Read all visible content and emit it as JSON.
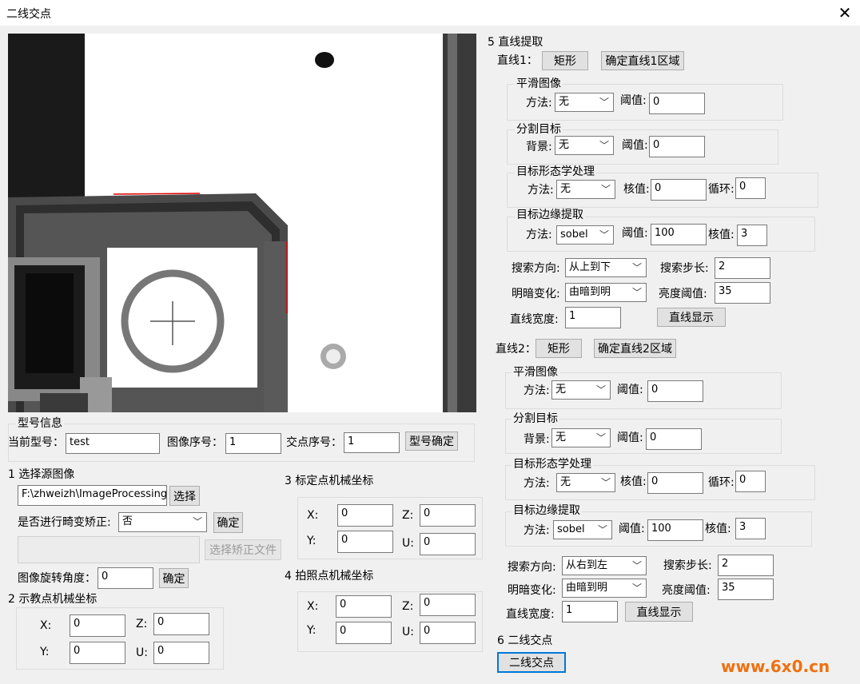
{
  "window": {
    "title": "二线交点",
    "close_glyph": "✕"
  },
  "model": {
    "group": "型号信息",
    "current_model_label": "当前型号：",
    "current_model_value": "test",
    "image_no_label": "图像序号：",
    "image_no_value": "1",
    "cross_no_label": "交点序号：",
    "cross_no_value": "1",
    "confirm": "型号确定"
  },
  "source": {
    "title": "1 选择源图像",
    "path_value": "F:\\zhweizh\\ImageProcessing\\定",
    "select_btn": "选择",
    "distort_label": "是否进行畸变矫正:",
    "distort_value": "否",
    "confirm_btn": "确定",
    "correction_file_btn": "选择矫正文件",
    "rotate_label": "图像旋转角度：",
    "rotate_value": "0",
    "rotate_confirm": "确定"
  },
  "teach": {
    "title": "2 示教点机械坐标",
    "x_label": "X:",
    "x": "0",
    "y_label": "Y:",
    "y": "0",
    "z_label": "Z:",
    "z": "0",
    "u_label": "U:",
    "u": "0"
  },
  "calib": {
    "title": "3 标定点机械坐标",
    "x_label": "X:",
    "x": "0",
    "y_label": "Y:",
    "y": "0",
    "z_label": "Z:",
    "z": "0",
    "u_label": "U:",
    "u": "0"
  },
  "shoot": {
    "title": "4 拍照点机械坐标",
    "x_label": "X:",
    "x": "0",
    "y_label": "Y:",
    "y": "0",
    "z_label": "Z:",
    "z": "0",
    "u_label": "U:",
    "u": "0"
  },
  "extract": {
    "title": "5 直线提取"
  },
  "line1": {
    "label": "直线1：",
    "rect_btn": "矩形",
    "region_btn": "确定直线1区域",
    "smooth": {
      "title": "平滑图像",
      "method_label": "方法:",
      "method": "无",
      "thresh_label": "阈值:",
      "thresh": "0"
    },
    "segment": {
      "title": "分割目标",
      "bg_label": "背景:",
      "bg": "无",
      "thresh_label": "阈值:",
      "thresh": "0"
    },
    "morph": {
      "title": "目标形态学处理",
      "method_label": "方法:",
      "method": "无",
      "kernel_label": "核值:",
      "kernel": "0",
      "loop_label": "循环:",
      "loop": "0"
    },
    "edge": {
      "title": "目标边缘提取",
      "method_label": "方法:",
      "method": "sobel",
      "thresh_label": "阈值:",
      "thresh": "100",
      "kernel_label": "核值:",
      "kernel": "3"
    },
    "dir_label": "搜索方向:",
    "dir": "从上到下",
    "step_label": "搜索步长:",
    "step": "2",
    "contrast_label": "明暗变化:",
    "contrast": "由暗到明",
    "brightness_label": "亮度阈值:",
    "brightness": "35",
    "width_label": "直线宽度:",
    "width": "1",
    "show_btn": "直线显示"
  },
  "line2": {
    "label": "直线2：",
    "rect_btn": "矩形",
    "region_btn": "确定直线2区域",
    "smooth": {
      "title": "平滑图像",
      "method_label": "方法:",
      "method": "无",
      "thresh_label": "阈值:",
      "thresh": "0"
    },
    "segment": {
      "title": "分割目标",
      "bg_label": "背景:",
      "bg": "无",
      "thresh_label": "阈值:",
      "thresh": "0"
    },
    "morph": {
      "title": "目标形态学处理",
      "method_label": "方法:",
      "method": "无",
      "kernel_label": "核值:",
      "kernel": "0",
      "loop_label": "循环:",
      "loop": "0"
    },
    "edge": {
      "title": "目标边缘提取",
      "method_label": "方法:",
      "method": "sobel",
      "thresh_label": "阈值:",
      "thresh": "100",
      "kernel_label": "核值:",
      "kernel": "3"
    },
    "dir_label": "搜索方向:",
    "dir": "从右到左",
    "step_label": "搜索步长:",
    "step": "2",
    "contrast_label": "明暗变化:",
    "contrast": "由暗到明",
    "brightness_label": "亮度阈值:",
    "brightness": "35",
    "width_label": "直线宽度:",
    "width": "1",
    "show_btn": "直线显示"
  },
  "cross": {
    "title": "6 二线交点",
    "btn": "二线交点"
  },
  "watermark": "www.6x0.cn",
  "colors": {
    "accent": "#0078d7",
    "watermark": "#f07010",
    "edge_red": "#e00000"
  },
  "icons": {
    "dropdown": "chevron-down-icon",
    "close": "close-icon"
  }
}
